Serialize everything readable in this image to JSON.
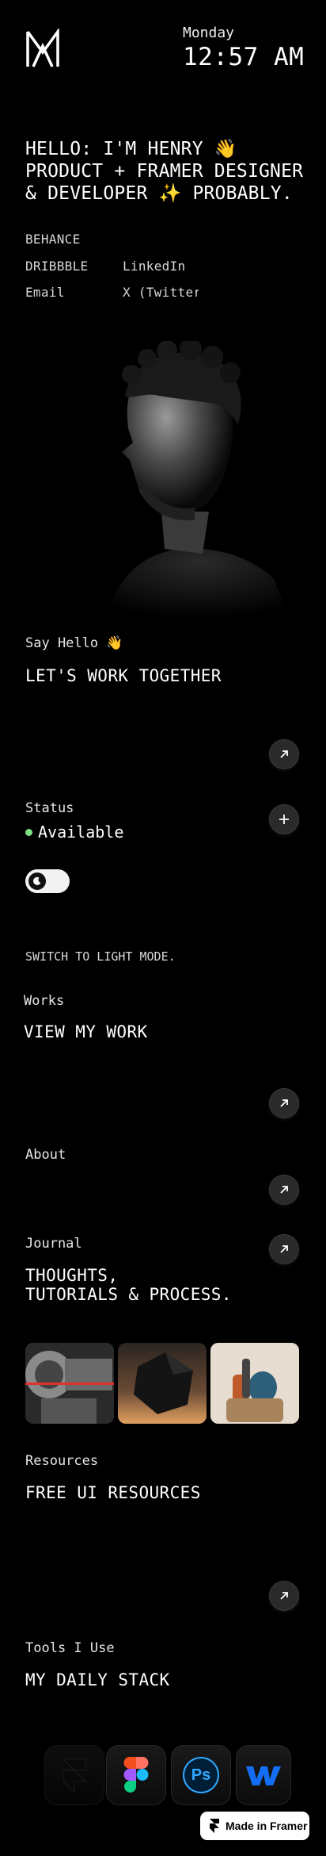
{
  "header": {
    "day": "Monday",
    "time": "12:57 AM",
    "logo_letters": "MA"
  },
  "hero": {
    "line1": "HELLO: I'M HENRY 👋",
    "line2": "PRODUCT + FRAMER DESIGNER",
    "line3": "& DEVELOPER ✨ PROBABLY."
  },
  "social": {
    "behance": "BEHANCE",
    "dribbble": "DRIBBBLE",
    "linkedin": "LinkedIn",
    "email": "Email",
    "twitter": "X (Twitter"
  },
  "contact": {
    "label": "Say Hello 👋",
    "title": "LET'S WORK TOGETHER"
  },
  "status": {
    "label": "Status",
    "value": "Available",
    "color": "#7ee07e"
  },
  "mode": {
    "switch_text": "SWITCH TO LIGHT MODE."
  },
  "works": {
    "label": "Works",
    "title": "VIEW MY WORK"
  },
  "about": {
    "label": "About"
  },
  "journal": {
    "label": "Journal",
    "line1": "THOUGHTS,",
    "line2": "TUTORIALS & PROCESS."
  },
  "resources": {
    "label": "Resources",
    "title": "FREE UI RESOURCES"
  },
  "tools": {
    "label": "Tools I Use",
    "title": "MY DAILY STACK",
    "items": [
      "framer-icon",
      "figma-icon",
      "photoshop-icon",
      "webflow-icon"
    ],
    "ps_text": "Ps"
  },
  "badge": {
    "text": "Made in Framer"
  }
}
